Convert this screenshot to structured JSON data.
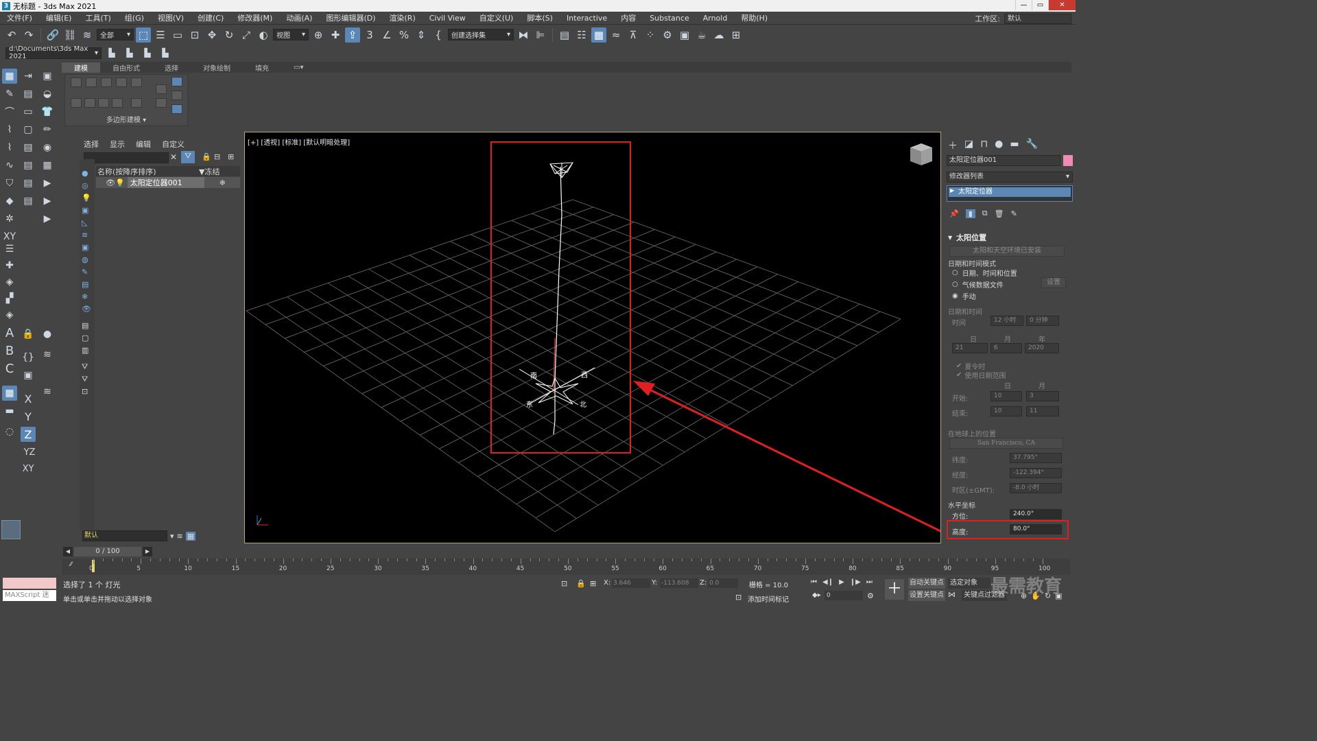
{
  "window": {
    "title": "无标题 - 3ds Max 2021",
    "app_icon_label": "3"
  },
  "menu": [
    "文件(F)",
    "编辑(E)",
    "工具(T)",
    "组(G)",
    "视图(V)",
    "创建(C)",
    "修改器(M)",
    "动画(A)",
    "图形编辑器(D)",
    "渲染(R)",
    "Civil View",
    "自定义(U)",
    "脚本(S)",
    "Interactive",
    "内容",
    "Substance",
    "Arnold",
    "帮助(H)"
  ],
  "workspace": {
    "label": "工作区:",
    "value": "默认"
  },
  "toolbar": {
    "selection_filter": "全部",
    "ref_coord": "视图",
    "named_selection": "创建选择集",
    "percent_icon": "%"
  },
  "project_path": "d:\\Documents\\3ds Max 2021",
  "ribbon": {
    "tabs": [
      "建模",
      "自由形式",
      "选择",
      "对象绘制",
      "填充"
    ],
    "panel_label": "多边形建模 ▾"
  },
  "left_tools": {
    "axis_x": "X",
    "axis_y": "Y",
    "axis_z": "Z",
    "axis_yz": "YZ",
    "axis_xy": "XY"
  },
  "explorer": {
    "menu": [
      "选择",
      "显示",
      "编辑",
      "自定义"
    ],
    "col_name": "名称(按降序排序)",
    "col_frozen": "▼冻结",
    "object_name": "太阳定位器001",
    "layer": "默认"
  },
  "viewport": {
    "label": "[+] [透视] [标准] [默认明暗处理]",
    "compass": {
      "south": "南",
      "west": "西",
      "east": "东",
      "north": "北"
    }
  },
  "cmdpanel": {
    "object_name": "太阳定位器001",
    "modifier_list": "修改器列表",
    "modifier": "太阳定位器",
    "rollout_title": "太阳位置",
    "sky_installed": "太阳和天空环境已安装",
    "date_mode_label": "日期和时间模式",
    "mode_datetime": "日期、时间和位置",
    "mode_weather": "气候数据文件",
    "settings_btn": "设置",
    "mode_manual": "手动",
    "datetime_group": "日期和时间",
    "time_label": "时间",
    "hour": "12 小时",
    "minute": "0 分钟",
    "day_label": "日",
    "month_label": "月",
    "year_label": "年",
    "day": "21",
    "month": "6",
    "year": "2020",
    "dst": "夏令时",
    "use_range": "使用日期范围",
    "range_day": "日",
    "range_month": "月",
    "start_label": "开始:",
    "start_day": "10",
    "start_month": "3",
    "end_label": "结束:",
    "end_day": "10",
    "end_month": "11",
    "location_group": "在地球上的位置",
    "city": "San Francisco, CA",
    "lat_label": "纬度:",
    "lat": "37.795°",
    "lon_label": "经度:",
    "lon": "-122.394°",
    "tz_label": "时区(±GMT):",
    "tz": "-8.0 小时",
    "horizontal_group": "水平坐标",
    "azimuth_label": "方位:",
    "azimuth": "240.0°",
    "altitude_label": "高度:",
    "altitude": "80.0°"
  },
  "timeline": {
    "frame": "0 / 100",
    "ticks": [
      "0",
      "5",
      "10",
      "15",
      "20",
      "25",
      "30",
      "35",
      "40",
      "45",
      "50",
      "55",
      "60",
      "65",
      "70",
      "75",
      "80",
      "85",
      "90",
      "95",
      "100"
    ]
  },
  "status": {
    "maxscript": "MAXScript 迷",
    "selected": "选择了 1 个 灯光",
    "prompt": "单击或单击并拖动以选择对象",
    "x_label": "X:",
    "x": "3.646",
    "y_label": "Y:",
    "y": "-113.608",
    "z_label": "Z:",
    "z": "0.0",
    "grid": "栅格 = 10.0",
    "add_time_tag": "添加时间标记",
    "auto_key": "自动关键点",
    "selected_obj": "选定对象",
    "set_key": "设置关键点",
    "key_filters": "关键点过滤器",
    "current_frame": "0",
    "watermark": "最需教育"
  },
  "colors": {
    "highlight": "#e02020",
    "active_blue": "#5a87b5",
    "viewport_bg": "#000000",
    "object_swatch": "#f08cb4"
  }
}
